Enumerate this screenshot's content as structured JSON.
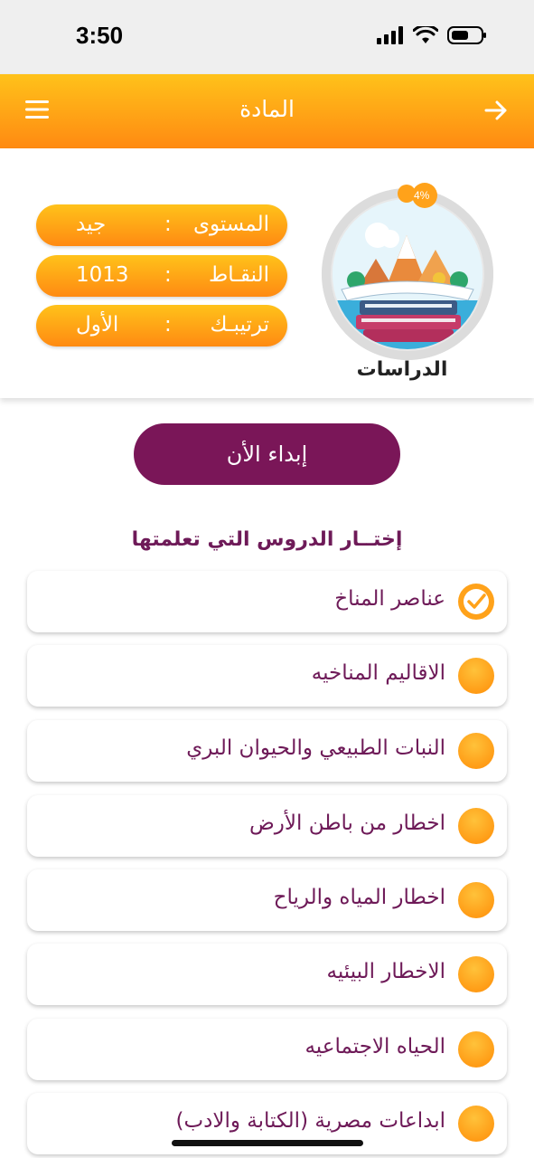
{
  "status_bar": {
    "time": "3:50"
  },
  "header": {
    "title": "المادة"
  },
  "profile": {
    "subject": "الدراسات",
    "progress_percent": "4%",
    "stats": [
      {
        "label": "المستوى",
        "value": "جيد"
      },
      {
        "label": "النقـاط",
        "value": "1013"
      },
      {
        "label": "ترتيبـك",
        "value": "الأول"
      }
    ]
  },
  "start_button": {
    "label": "إبداء الأن"
  },
  "lessons_section": {
    "title": "إختــار الدروس التي تعلمتها",
    "items": [
      {
        "label": "عناصر المناخ",
        "completed": true
      },
      {
        "label": "الاقاليم المناخيه",
        "completed": false
      },
      {
        "label": "النبات الطبيعي والحيوان البري",
        "completed": false
      },
      {
        "label": "اخطار من باطن الأرض",
        "completed": false
      },
      {
        "label": "اخطار المياه والرياح",
        "completed": false
      },
      {
        "label": "الاخطار البيئيه",
        "completed": false
      },
      {
        "label": "الحياه الاجتماعيه",
        "completed": false
      },
      {
        "label": "ابداعات مصرية (الكتابة والادب)",
        "completed": false
      }
    ]
  },
  "colors": {
    "accent": "#ff9a14",
    "brand": "#7a1658",
    "text": "#6e1a58"
  }
}
